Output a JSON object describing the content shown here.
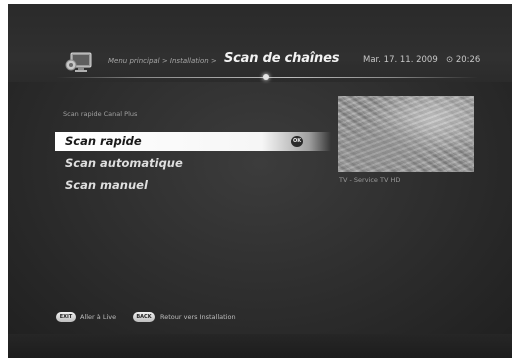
{
  "header": {
    "breadcrumb": "Menu principal > Installation >",
    "title": "Scan de chaînes",
    "date": "Mar. 17. 11. 2009",
    "clock": "⊙ 20:26",
    "icon": "tv-settings-icon"
  },
  "main": {
    "section_label": "Scan rapide Canal Plus",
    "menu": [
      {
        "label": "Scan rapide",
        "selected": true
      },
      {
        "label": "Scan automatique",
        "selected": false
      },
      {
        "label": "Scan manuel",
        "selected": false
      }
    ],
    "ok_badge": "OK"
  },
  "preview": {
    "caption": "TV - Service TV HD"
  },
  "footer": {
    "exit_key": "EXIT",
    "exit_label": "Aller à Live",
    "back_key": "BACK",
    "back_label": "Retour vers Installation"
  }
}
